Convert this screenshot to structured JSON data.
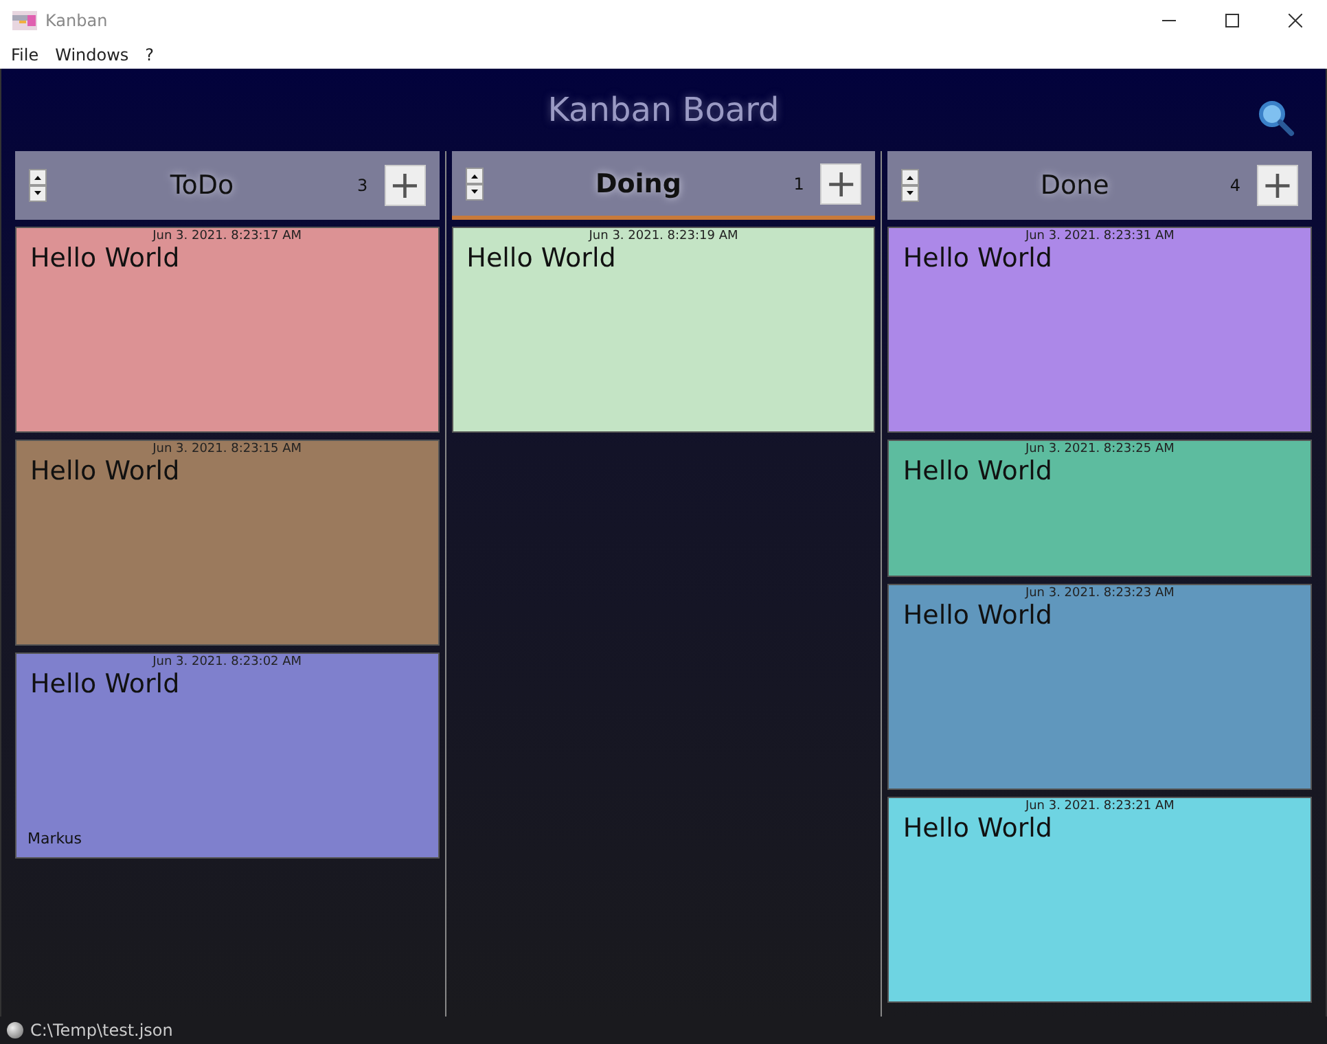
{
  "window": {
    "title": "Kanban"
  },
  "menu": [
    "File",
    "Windows",
    "?"
  ],
  "board": {
    "title": "Kanban Board"
  },
  "columns": [
    {
      "title": "ToDo",
      "count": "3",
      "selected": false,
      "add": "+",
      "cards": [
        {
          "date": "Jun 3. 2021. 8:23:17 AM",
          "text": "Hello World",
          "color": "#dc9294",
          "kind": "large"
        },
        {
          "date": "Jun 3. 2021. 8:23:15 AM",
          "text": "Hello World",
          "color": "#9b7a5d",
          "kind": "large"
        },
        {
          "date": "Jun 3. 2021. 8:23:02 AM",
          "text": "Hello World",
          "color": "#7f80cd",
          "kind": "large",
          "author": "Markus"
        }
      ]
    },
    {
      "title": "Doing",
      "count": "1",
      "selected": true,
      "add": "+",
      "cards": [
        {
          "date": "Jun 3. 2021. 8:23:19 AM",
          "text": "Hello World",
          "color": "#c4e4c5",
          "kind": "large"
        }
      ]
    },
    {
      "title": "Done",
      "count": "4",
      "selected": false,
      "add": "+",
      "cards": [
        {
          "date": "Jun 3. 2021. 8:23:31 AM",
          "text": "Hello World",
          "color": "#ac88e8",
          "kind": "large"
        },
        {
          "date": "Jun 3. 2021. 8:23:25 AM",
          "text": "Hello World",
          "color": "#5dbc9f",
          "kind": "small"
        },
        {
          "date": "Jun 3. 2021. 8:23:23 AM",
          "text": "Hello World",
          "color": "#6097bd",
          "kind": "large"
        },
        {
          "date": "Jun 3. 2021. 8:23:21 AM",
          "text": "Hello World",
          "color": "#6ed4e2",
          "kind": "large"
        }
      ]
    }
  ],
  "status_bar": {
    "path": "C:\\Temp\\test.json"
  }
}
